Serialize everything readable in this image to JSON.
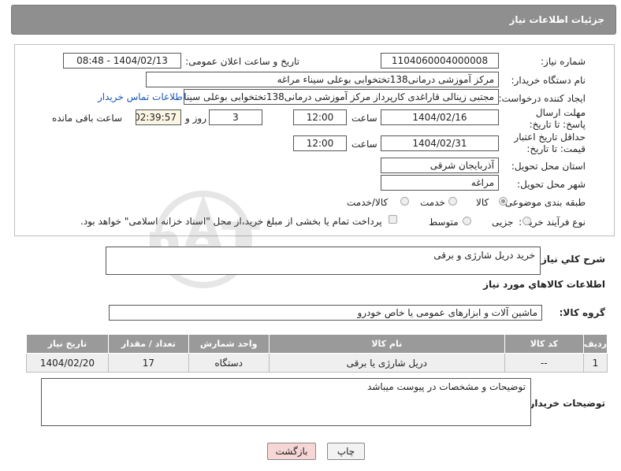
{
  "header": {
    "title": "جزئیات اطلاعات نیاز"
  },
  "form": {
    "need_number_label": "شماره نیاز:",
    "need_number": "1104060004000008",
    "announce_label": "تاریخ و ساعت اعلان عمومی:",
    "announce_value": "1404/02/13 - 08:48",
    "buyer_org_label": "نام دستگاه خریدار:",
    "buyer_org": "مرکز آموزشی درمانی138تختخوابی بوعلی سیناء مراغه",
    "requester_label": "ایجاد کننده درخواست:",
    "requester": "مجتبی زینالی قاراغدی کارپرداز مرکز آموزشی درمانی138تختخوابی بوعلی سینا",
    "contact_link": "اطلاعات تماس خریدار",
    "deadline_label": "مهلت ارسال پاسخ: تا تاریخ:",
    "deadline_date": "1404/02/16",
    "time_label": "ساعت",
    "deadline_time": "12:00",
    "days_value": "3",
    "days_label": "روز و",
    "remaining_time": "02:39:57",
    "remaining_label": "ساعت باقی مانده",
    "validity_label": "حداقل تاریخ اعتبار قیمت: تا تاریخ:",
    "validity_date": "1404/02/31",
    "validity_time_label": "ساعت",
    "validity_time": "12:00",
    "province_label": "استان محل تحویل:",
    "province": "آذربایجان شرقی",
    "city_label": "شهر محل تحویل:",
    "city": "مراغه",
    "category_label": "طبقه بندی موضوعی:",
    "category_options": [
      "کالا",
      "خدمت",
      "کالا/خدمت"
    ],
    "category_selected": "کالا",
    "process_label": "نوع فرآیند خرید :",
    "process_options": [
      "جزیی",
      "متوسط"
    ],
    "payment_note": "پرداخت تمام یا بخشی از مبلغ خرید،از محل \"اسناد خزانه اسلامی\" خواهد بود."
  },
  "description": {
    "label": "شرح کلي نياز:",
    "value": "خرید دریل شارژی و برقی"
  },
  "goods_section": {
    "title": "اطلاعات کالاهاي مورد نياز",
    "group_label": "گروه کالا:",
    "group_value": "ماشین آلات و ابزارهای عمومی یا خاص خودرو"
  },
  "table": {
    "headers": [
      "ردیف",
      "کد کالا",
      "نام کالا",
      "واحد شمارش",
      "تعداد / مقدار",
      "تاریخ نیاز"
    ],
    "rows": [
      [
        "1",
        "--",
        "دریل شارژی یا برقی",
        "دستگاه",
        "17",
        "1404/02/20"
      ]
    ]
  },
  "buyer_notes": {
    "label": "توضیحات خریدار:",
    "value": "توضیحات و مشخصات در پیوست میباشد"
  },
  "buttons": {
    "print": "چاپ",
    "back": "بازگشت"
  },
  "colors": {
    "header": "#8f8f8f",
    "link": "#1a55b0",
    "back_button": "#f7d6d6"
  },
  "watermark": "AriaTender.neT"
}
